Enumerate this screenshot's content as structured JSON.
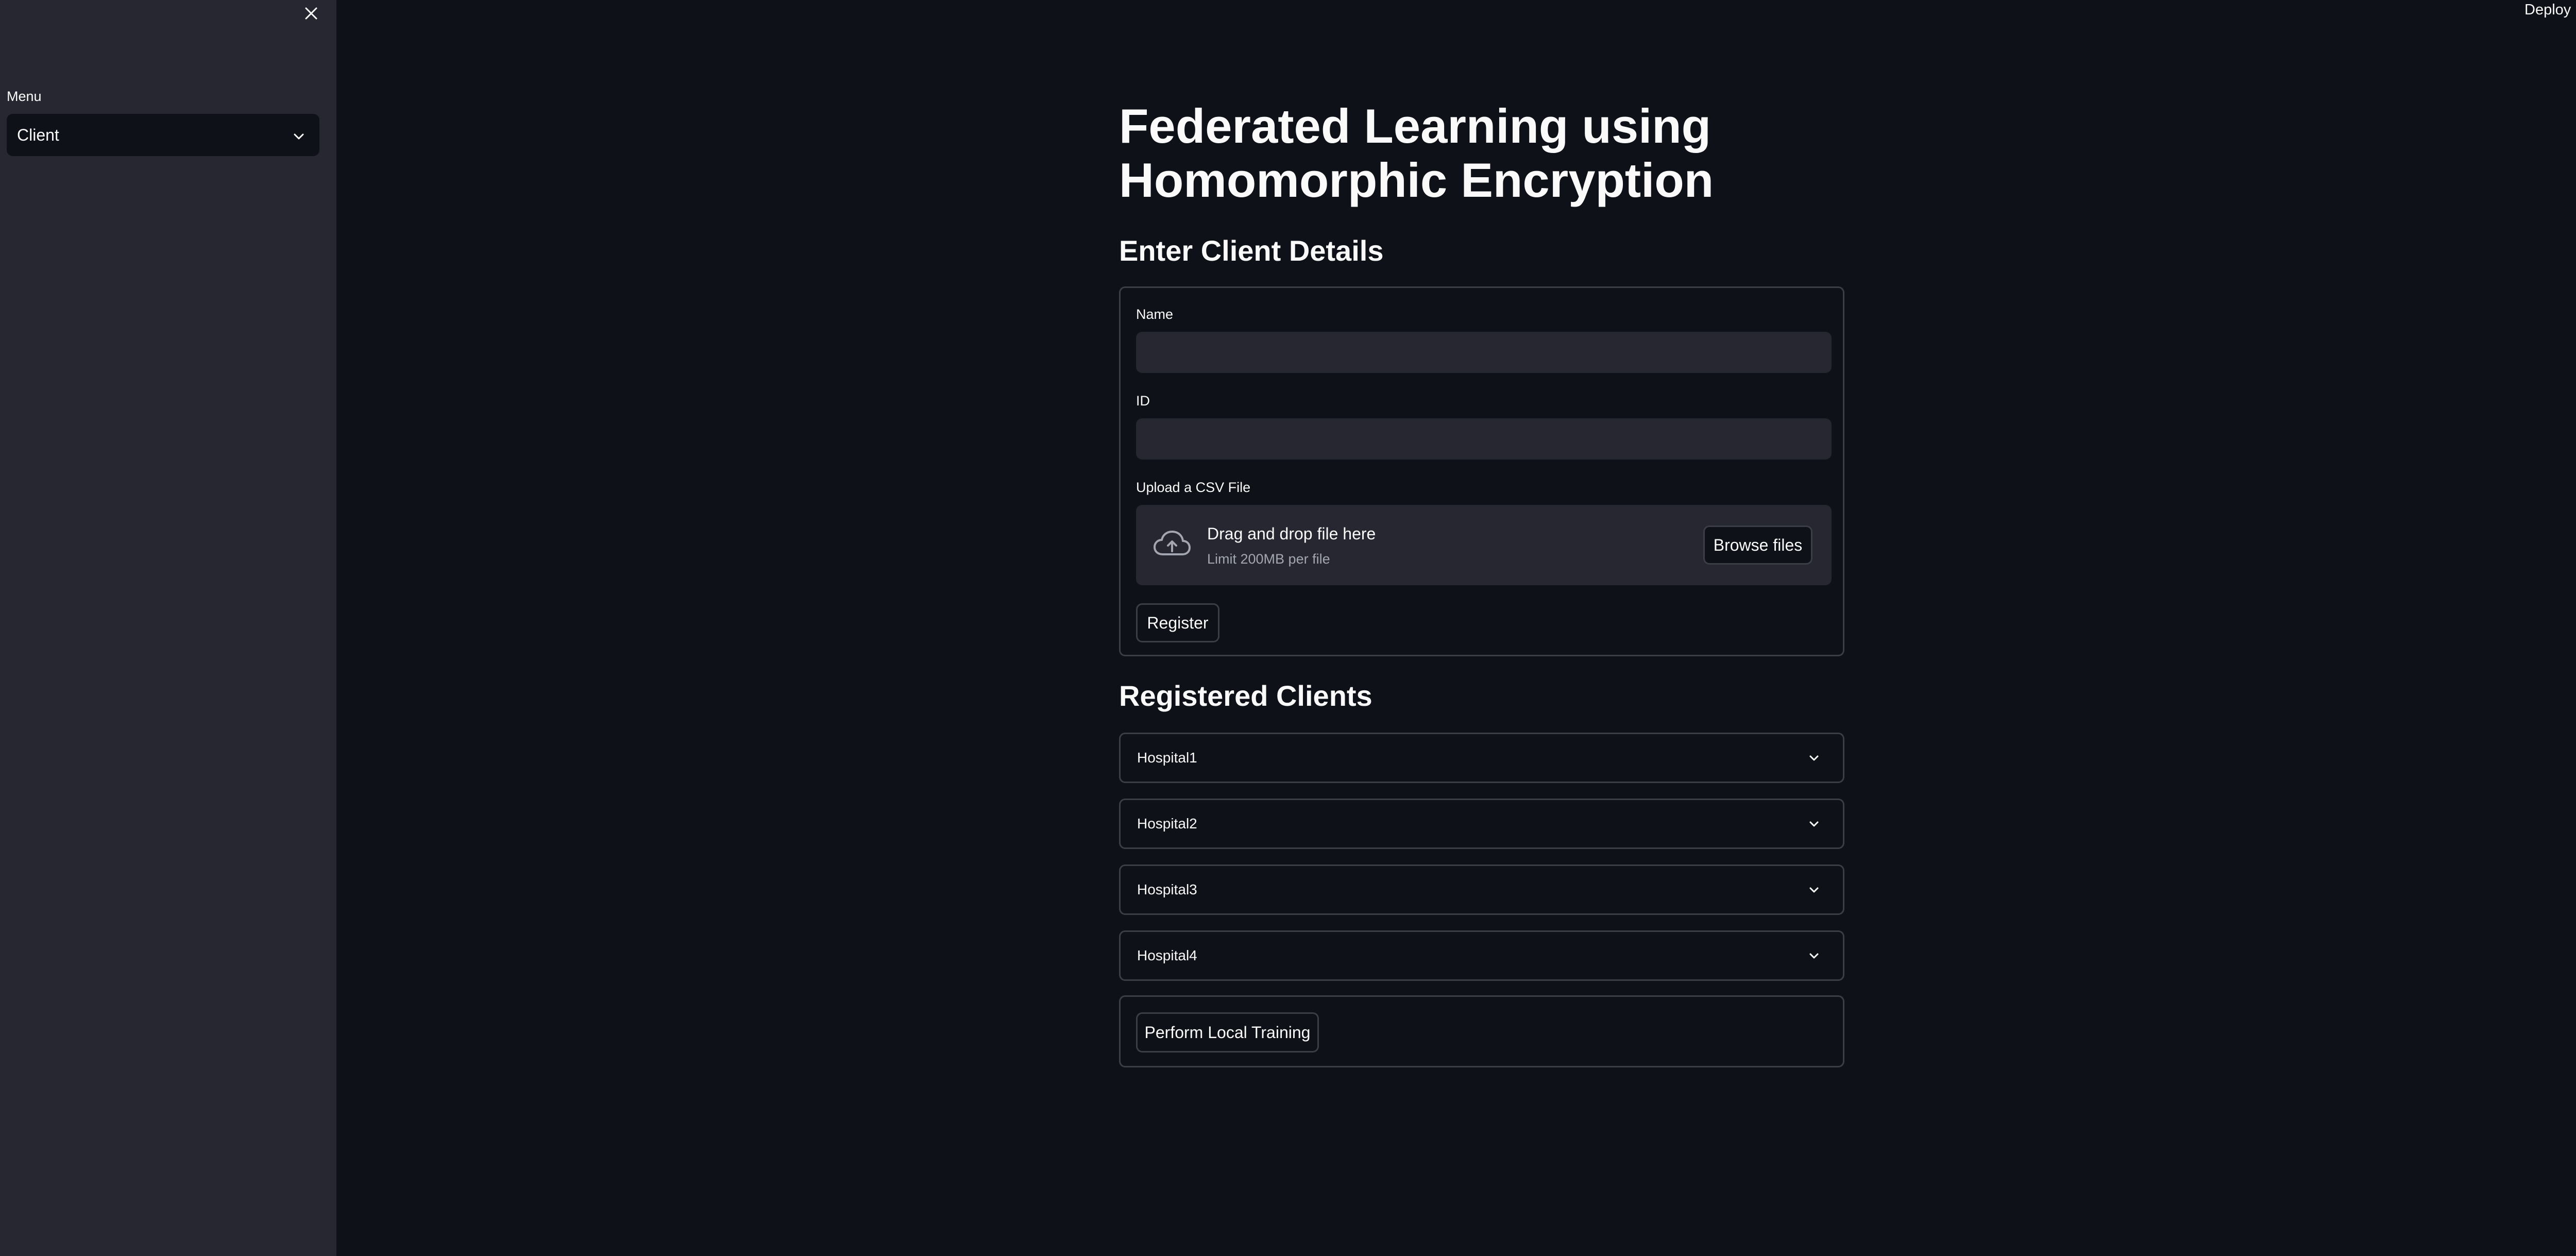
{
  "sidebar": {
    "menu_label": "Menu",
    "menu_selected": "Client",
    "icons": {
      "close": "close-icon",
      "chevron": "chevron-down-icon"
    }
  },
  "header": {
    "deploy_label": "Deploy",
    "menu_icon": "kebab-menu-icon"
  },
  "main": {
    "title": "Federated Learning using Homomorphic Encryption",
    "form_heading": "Enter Client Details",
    "form": {
      "name_label": "Name",
      "name_value": "",
      "id_label": "ID",
      "id_value": "",
      "upload_label": "Upload a CSV File",
      "dropzone_title": "Drag and drop file here",
      "dropzone_limit": "Limit 200MB per file",
      "browse_label": "Browse files",
      "register_label": "Register"
    },
    "clients_heading": "Registered Clients",
    "clients": [
      {
        "label": "Hospital1"
      },
      {
        "label": "Hospital2"
      },
      {
        "label": "Hospital3"
      },
      {
        "label": "Hospital4"
      }
    ],
    "train_label": "Perform Local Training"
  },
  "colors": {
    "background": "#0e1117",
    "sidebar": "#262730",
    "input": "#262730",
    "border": "#3b3d47",
    "text": "#fafafa",
    "muted": "#a3a6b0"
  }
}
